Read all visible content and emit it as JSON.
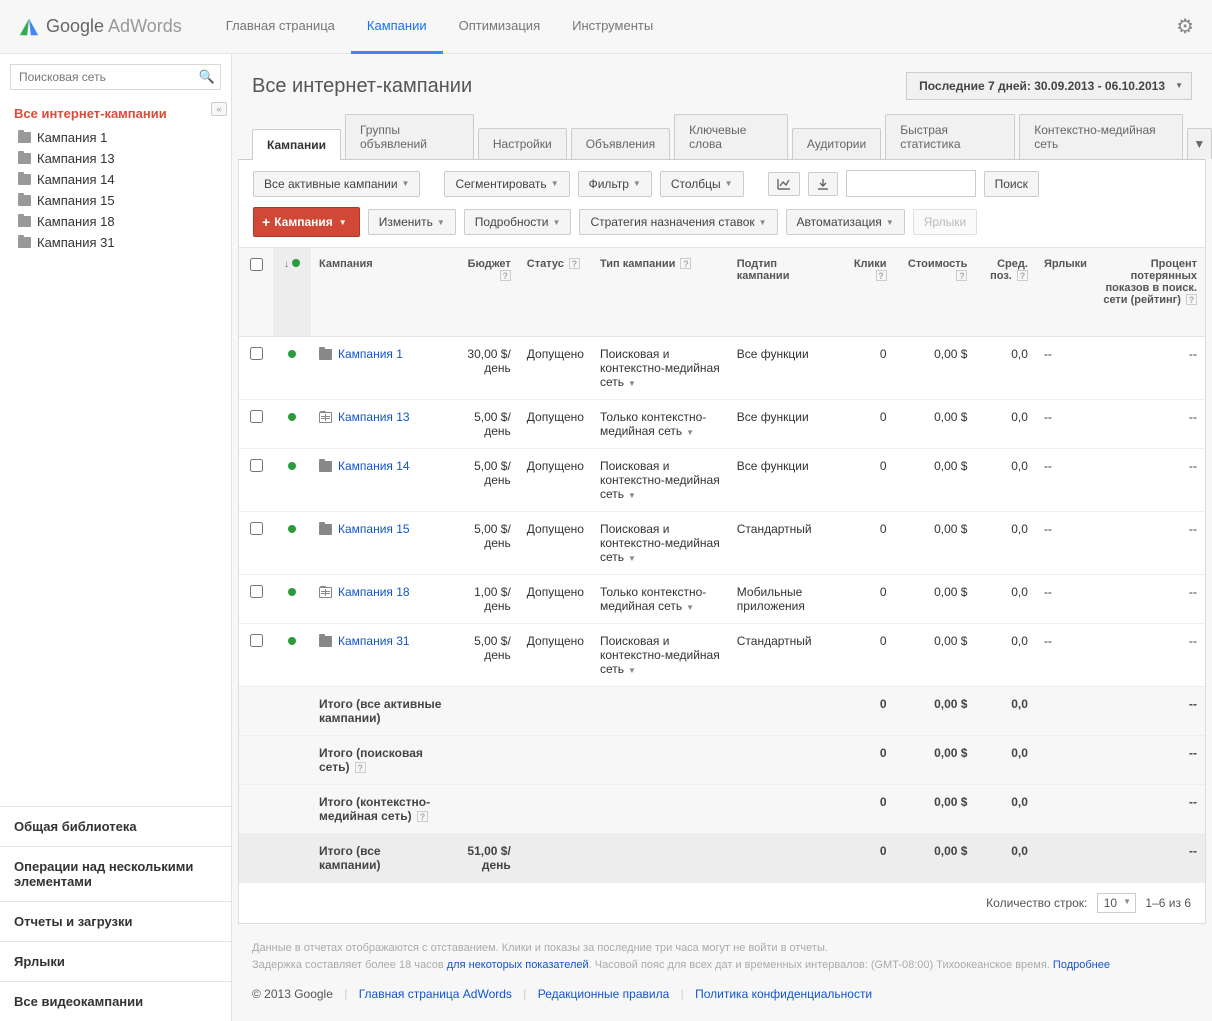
{
  "header": {
    "brand_g": "Google",
    "brand_aw": " AdWords",
    "nav": [
      "Главная страница",
      "Кампании",
      "Оптимизация",
      "Инструменты"
    ],
    "active_nav": 1
  },
  "sidebar": {
    "search_placeholder": "Поисковая сеть",
    "root": "Все интернет-кампании",
    "items": [
      "Кампания 1",
      "Кампания 13",
      "Кампания 14",
      "Кампания 15",
      "Кампания 18",
      "Кампания 31"
    ],
    "links": [
      "Общая библиотека",
      "Операции над несколькими элементами",
      "Отчеты и загрузки",
      "Ярлыки",
      "Все видеокампании"
    ]
  },
  "main": {
    "title": "Все интернет-кампании",
    "date_range": "Последние 7 дней: 30.09.2013 - 06.10.2013",
    "sub_tabs": [
      "Кампании",
      "Группы объявлений",
      "Настройки",
      "Объявления",
      "Ключевые слова",
      "Аудитории",
      "Быстрая статистика",
      "Контекстно-медийная сеть"
    ],
    "active_sub_tab": 0,
    "toolbar1": {
      "filter_campaigns": "Все активные кампании",
      "segment": "Сегментировать",
      "filter": "Фильтр",
      "columns": "Столбцы",
      "search_btn": "Поиск"
    },
    "toolbar2": {
      "campaign_btn": "Кампания",
      "edit": "Изменить",
      "details": "Подробности",
      "bid_strategy": "Стратегия назначения ставок",
      "automation": "Автоматизация",
      "labels": "Ярлыки"
    },
    "columns": {
      "campaign": "Кампания",
      "budget": "Бюджет",
      "status": "Статус",
      "type": "Тип кампании",
      "subtype": "Подтип кампании",
      "clicks": "Клики",
      "cost": "Стоимость",
      "avgpos": "Сред. поз.",
      "labels": "Ярлыки",
      "lost_is": "Процент потерянных показов в поиск. сети (рейтинг)"
    },
    "rows": [
      {
        "name": "Кампания 1",
        "icon": "folder",
        "budget": "30,00 $/день",
        "status": "Допущено",
        "type": "Поисковая и контекстно-медийная сеть",
        "subtype": "Все функции",
        "clicks": "0",
        "cost": "0,00 $",
        "avgpos": "0,0",
        "labels": "--",
        "lost": "--"
      },
      {
        "name": "Кампания 13",
        "icon": "grid",
        "budget": "5,00 $/день",
        "status": "Допущено",
        "type": "Только контекстно-медийная сеть",
        "subtype": "Все функции",
        "clicks": "0",
        "cost": "0,00 $",
        "avgpos": "0,0",
        "labels": "--",
        "lost": "--"
      },
      {
        "name": "Кампания 14",
        "icon": "folder",
        "budget": "5,00 $/день",
        "status": "Допущено",
        "type": "Поисковая и контекстно-медийная сеть",
        "subtype": "Все функции",
        "clicks": "0",
        "cost": "0,00 $",
        "avgpos": "0,0",
        "labels": "--",
        "lost": "--"
      },
      {
        "name": "Кампания 15",
        "icon": "folder",
        "budget": "5,00 $/день",
        "status": "Допущено",
        "type": "Поисковая и контекстно-медийная сеть",
        "subtype": "Стандартный",
        "clicks": "0",
        "cost": "0,00 $",
        "avgpos": "0,0",
        "labels": "--",
        "lost": "--"
      },
      {
        "name": "Кампания 18",
        "icon": "grid",
        "budget": "1,00 $/день",
        "status": "Допущено",
        "type": "Только контекстно-медийная сеть",
        "subtype": "Мобильные приложения",
        "clicks": "0",
        "cost": "0,00 $",
        "avgpos": "0,0",
        "labels": "--",
        "lost": "--"
      },
      {
        "name": "Кампания 31",
        "icon": "folder",
        "budget": "5,00 $/день",
        "status": "Допущено",
        "type": "Поисковая и контекстно-медийная сеть",
        "subtype": "Стандартный",
        "clicks": "0",
        "cost": "0,00 $",
        "avgpos": "0,0",
        "labels": "--",
        "lost": "--"
      }
    ],
    "totals": [
      {
        "label": "Итого (все активные кампании)",
        "budget": "",
        "clicks": "0",
        "cost": "0,00 $",
        "avgpos": "0,0",
        "lost": "--",
        "help": false
      },
      {
        "label": "Итого (поисковая сеть)",
        "budget": "",
        "clicks": "0",
        "cost": "0,00 $",
        "avgpos": "0,0",
        "lost": "--",
        "help": true
      },
      {
        "label": "Итого (контекстно-медийная сеть)",
        "budget": "",
        "clicks": "0",
        "cost": "0,00 $",
        "avgpos": "0,0",
        "lost": "--",
        "help": true
      }
    ],
    "grand": {
      "label": "Итого (все кампании)",
      "budget": "51,00 $/день",
      "clicks": "0",
      "cost": "0,00 $",
      "avgpos": "0,0",
      "lost": "--"
    },
    "pager": {
      "rows_label": "Количество строк:",
      "rows_value": "10",
      "range": "1–6 из 6"
    }
  },
  "footer": {
    "note1": "Данные в отчетах отображаются с отставанием. Клики и показы за последние три часа могут не войти в отчеты.",
    "note2a": "Задержка составляет более 18 часов ",
    "note2_link": "для некоторых показателей",
    "note2b": ". Часовой пояс для всех дат и временных интервалов: (GMT-08:00) Тихоокеанское время. ",
    "more": "Подробнее",
    "copyright": "© 2013 Google",
    "links": [
      "Главная страница AdWords",
      "Редакционные правила",
      "Политика конфиденциальности"
    ]
  }
}
